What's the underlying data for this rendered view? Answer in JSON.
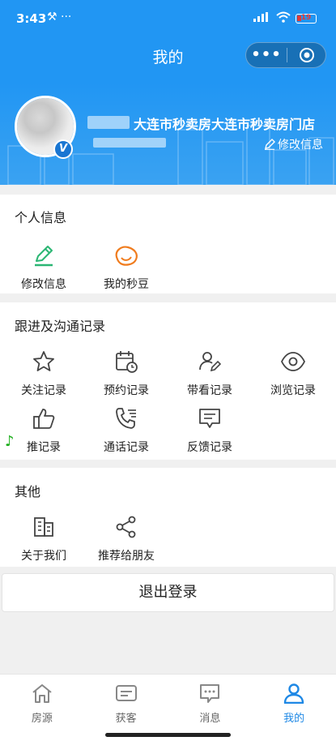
{
  "status_bar": {
    "time": "3:43",
    "extra": "⚒ ···",
    "signal": "5G",
    "battery": "19"
  },
  "navbar": {
    "title": "我的",
    "more_label": "•••"
  },
  "profile": {
    "store_name": "大连市秒卖房大连市秒卖房门店",
    "edit_label": "修改信息",
    "badge": "V"
  },
  "sections": {
    "personal": {
      "title": "个人信息",
      "items": [
        {
          "label": "修改信息",
          "icon": "pencil-icon"
        },
        {
          "label": "我的秒豆",
          "icon": "bean-icon"
        }
      ]
    },
    "records": {
      "title": "跟进及沟通记录",
      "items": [
        {
          "label": "关注记录",
          "icon": "star-icon"
        },
        {
          "label": "预约记录",
          "icon": "calendar-clock-icon"
        },
        {
          "label": "带看记录",
          "icon": "users-pen-icon"
        },
        {
          "label": "浏览记录",
          "icon": "eye-icon"
        },
        {
          "label": "推记录",
          "icon": "thumbs-up-icon"
        },
        {
          "label": "通话记录",
          "icon": "phone-list-icon"
        },
        {
          "label": "反馈记录",
          "icon": "feedback-icon"
        }
      ]
    },
    "other": {
      "title": "其他",
      "items": [
        {
          "label": "关于我们",
          "icon": "building-icon"
        },
        {
          "label": "推荐给朋友",
          "icon": "share-icon"
        }
      ]
    }
  },
  "logout_label": "退出登录",
  "tabbar": [
    {
      "label": "房源",
      "icon": "home-icon",
      "active": false
    },
    {
      "label": "获客",
      "icon": "card-icon",
      "active": false
    },
    {
      "label": "消息",
      "icon": "chat-icon",
      "active": false
    },
    {
      "label": "我的",
      "icon": "person-icon",
      "active": true
    }
  ],
  "colors": {
    "primary": "#2196f3",
    "accent_green": "#2bb673",
    "accent_orange": "#f07c1e",
    "active_tab": "#1e88e5"
  }
}
